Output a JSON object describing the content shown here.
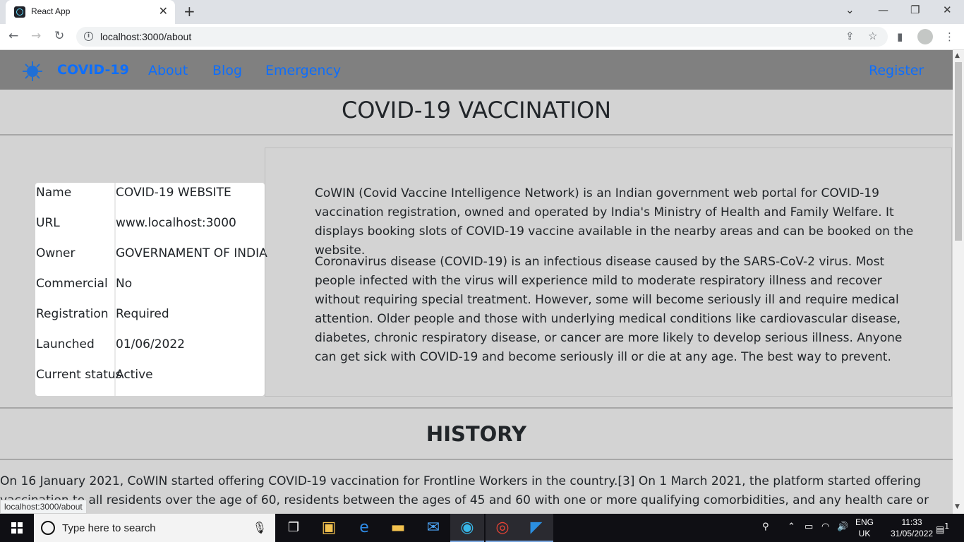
{
  "browser": {
    "tab_title": "React App",
    "url": "localhost:3000/about",
    "status_url": "localhost:3000/about"
  },
  "navbar": {
    "brand": "COVID-19",
    "links": [
      "About",
      "Blog",
      "Emergency"
    ],
    "register": "Register",
    "link_color": "#0d6efd"
  },
  "vaccination": {
    "title": "COVID-19 VACCINATION",
    "info": [
      {
        "key": "Name",
        "value": "COVID-19 WEBSITE"
      },
      {
        "key": "URL",
        "value": "www.localhost:3000"
      },
      {
        "key": "Owner",
        "value": "GOVERNAMENT OF INDIA"
      },
      {
        "key": "Commercial",
        "value": "No"
      },
      {
        "key": "Registration",
        "value": "Required"
      },
      {
        "key": "Launched",
        "value": "01/06/2022"
      },
      {
        "key": "Current status",
        "value": "Active"
      }
    ],
    "paragraphs": [
      "CoWIN (Covid Vaccine Intelligence Network) is an Indian government web portal for COVID-19 vaccination registration, owned and operated by India's Ministry of Health and Family Welfare. It displays booking slots of COVID-19 vaccine available in the nearby areas and can be booked on the website.",
      "Coronavirus disease (COVID-19) is an infectious disease caused by the SARS-CoV-2 virus. Most people infected with the virus will experience mild to moderate respiratory illness and recover without requiring special treatment. However, some will become seriously ill and require medical attention. Older people and those with underlying medical conditions like cardiovascular disease, diabetes, chronic respiratory disease, or cancer are more likely to develop serious illness. Anyone can get sick with COVID-19 and become seriously ill or die at any age. The best way to prevent."
    ]
  },
  "history": {
    "title": "HISTORY",
    "text": "On 16 January 2021, CoWIN started offering COVID-19 vaccination for Frontline Workers in the country.[3] On 1 March 2021, the platform started offering vaccination to all residents over the age of 60, residents between the ages of 45 and 60 with one or more qualifying comorbidities, and any health care or frontline worker that did not"
  },
  "taskbar": {
    "search_placeholder": "Type here to search",
    "lang_line1": "ENG",
    "lang_line2": "UK",
    "time": "11:33",
    "date": "31/05/2022",
    "notification_count": "1",
    "apps": [
      "task-view",
      "store",
      "edge",
      "file-explorer",
      "mail",
      "edge-dev",
      "chrome",
      "vscode"
    ]
  }
}
